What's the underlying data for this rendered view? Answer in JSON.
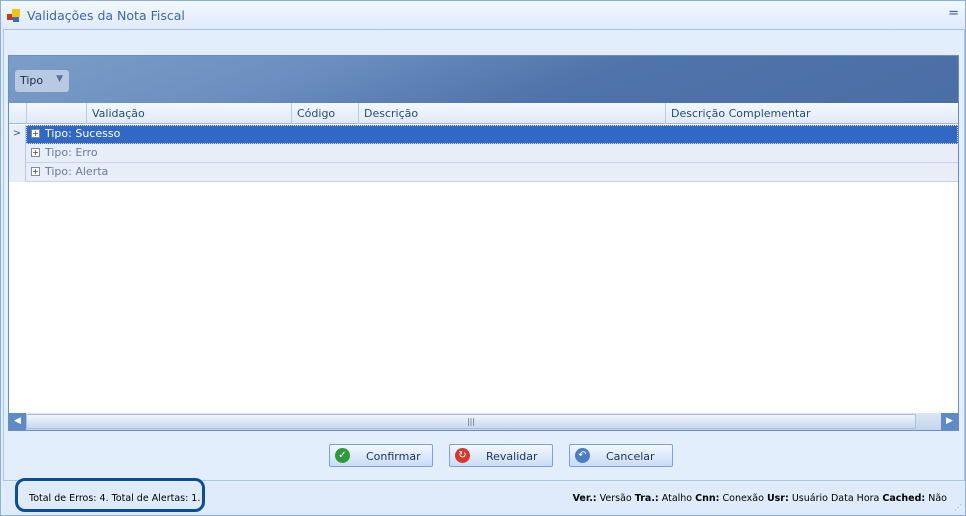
{
  "window": {
    "title": "Validações da Nota Fiscal",
    "minimize_glyph": "="
  },
  "group_panel": {
    "chip": "Tipo"
  },
  "columns": [
    "Validação",
    "Código",
    "Descrição",
    "Descrição Complementar"
  ],
  "rows": [
    {
      "label": "Tipo: Sucesso",
      "selected": true
    },
    {
      "label": "Tipo: Erro"
    },
    {
      "label": "Tipo: Alerta"
    }
  ],
  "buttons": {
    "confirm": "Confirmar",
    "revalidate": "Revalidar",
    "cancel": "Cancelar"
  },
  "status": {
    "totals": "Total de Erros: 4. Total de Alertas: 1.",
    "ver_label": "Ver.:",
    "ver": "Versão",
    "tra_label": "Tra.:",
    "tra": "Atalho",
    "cnn_label": "Cnn:",
    "cnn": "Conexão",
    "usr_label": "Usr:",
    "usr": "Usuário",
    "datetime": "Data Hora",
    "cached_label": "Cached:",
    "cached": "Não"
  }
}
